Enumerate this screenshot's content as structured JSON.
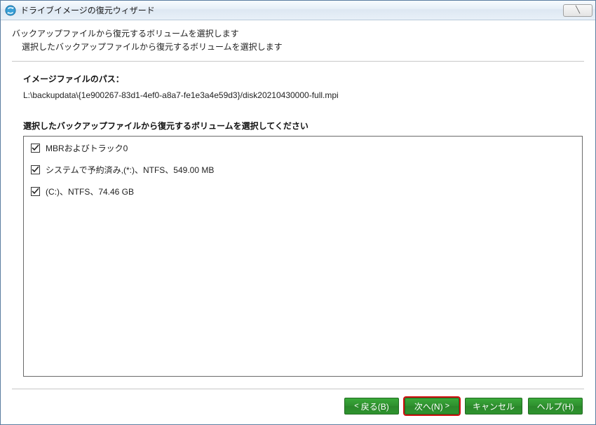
{
  "titlebar": {
    "title": "ドライブイメージの復元ウィザード",
    "close_symbol": "╲"
  },
  "header": {
    "line1": "バックアップファイルから復元するボリュームを選択します",
    "line2": "選択したバックアップファイルから復元するボリュームを選択します"
  },
  "path_section": {
    "label": "イメージファイルのパス：",
    "value": "L:\\backupdata\\{1e900267-83d1-4ef0-a8a7-fe1e3a4e59d3}/disk20210430000-full.mpi"
  },
  "volumes_section": {
    "label": "選択したバックアップファイルから復元するボリュームを選択してください",
    "items": [
      {
        "checked": true,
        "label": "MBRおよびトラック0"
      },
      {
        "checked": true,
        "label": "システムで予約済み,(*:)、NTFS、549.00 MB"
      },
      {
        "checked": true,
        "label": "(C:)、NTFS、74.46 GB"
      }
    ]
  },
  "footer": {
    "back": "戻る(B)",
    "next": "次へ(N)",
    "cancel": "キャンセル",
    "help": "ヘルプ(H)",
    "chev_left": "<",
    "chev_right": ">"
  }
}
